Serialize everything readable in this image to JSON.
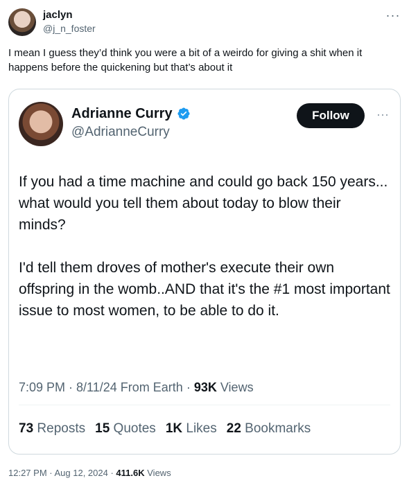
{
  "outer_tweet": {
    "display_name": "jaclyn",
    "handle": "@j_n_foster",
    "more_icon": "more-horizontal-icon",
    "text": "I mean I guess they’d think you were a bit of a weirdo for giving a shit when it happens before the quickening but that’s about it"
  },
  "quoted_tweet": {
    "display_name": "Adrianne Curry",
    "handle": "@AdrianneCurry",
    "verified_color": "#1d9bf0",
    "follow_label": "Follow",
    "paragraphs": [
      "If you had a time machine and could go back 150 years... what would you tell them about today to blow their minds?",
      "I'd tell them droves of mother's execute their own offspring in the womb..AND that it's the #1 most important issue to most women, to be able to do it."
    ],
    "time": "7:09 PM",
    "date": "8/11/24",
    "source": "From Earth",
    "views_count": "93K",
    "views_label": "Views",
    "reposts_count": "73",
    "reposts_label": "Reposts",
    "quotes_count": "15",
    "quotes_label": "Quotes",
    "likes_count": "1K",
    "likes_label": "Likes",
    "bookmarks_count": "22",
    "bookmarks_label": "Bookmarks"
  },
  "footer": {
    "time": "12:27 PM",
    "date": "Aug 12, 2024",
    "views_count": "411.6K",
    "views_label": "Views"
  },
  "separator": " · "
}
